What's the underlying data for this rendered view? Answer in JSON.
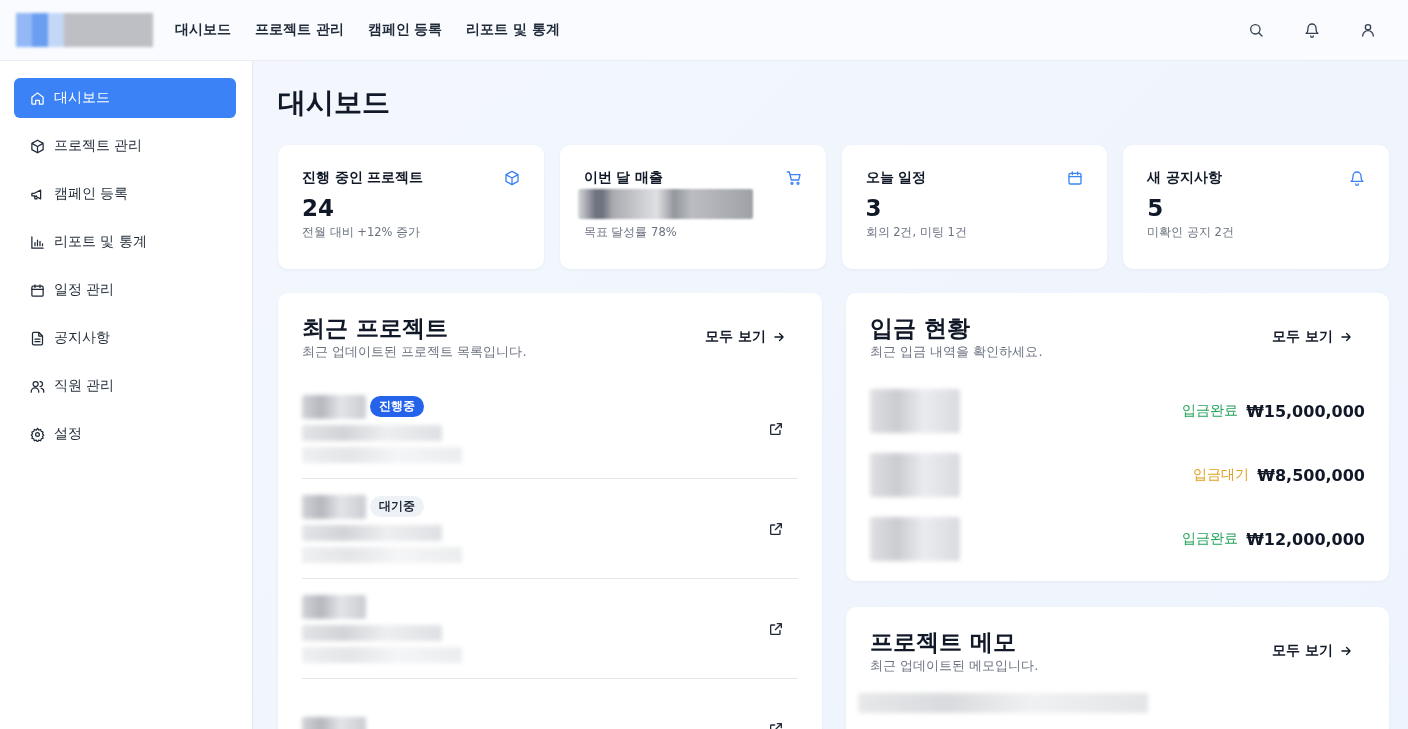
{
  "header": {
    "nav": [
      "대시보드",
      "프로젝트 관리",
      "캠페인 등록",
      "리포트 및 통계"
    ]
  },
  "sidebar": {
    "items": [
      {
        "label": "대시보드",
        "selected": true
      },
      {
        "label": "프로젝트 관리",
        "selected": false
      },
      {
        "label": "캠페인 등록",
        "selected": false
      },
      {
        "label": "리포트 및 통계",
        "selected": false
      },
      {
        "label": "일정 관리",
        "selected": false
      },
      {
        "label": "공지사항",
        "selected": false
      },
      {
        "label": "직원 관리",
        "selected": false
      },
      {
        "label": "설정",
        "selected": false
      }
    ]
  },
  "page_title": "대시보드",
  "stats": [
    {
      "title": "진행 중인 프로젝트",
      "value": "24",
      "note": "전월 대비 +12% 증가"
    },
    {
      "title": "이번 달 매출",
      "note": "목표 달성률 78%"
    },
    {
      "title": "오늘 일정",
      "value": "3",
      "note": "회의 2건, 미팅 1건"
    },
    {
      "title": "새 공지사항",
      "value": "5",
      "note": "미확인 공지 2건"
    }
  ],
  "recent_projects": {
    "title": "최근 프로젝트",
    "subtitle": "최근 업데이트된 프로젝트 목록입니다.",
    "link": "모두 보기",
    "rows": [
      {
        "kind": "active",
        "badge": "진행중"
      },
      {
        "kind": "waiting",
        "badge": "대기중"
      },
      {},
      {}
    ]
  },
  "deposits": {
    "title": "입금 현황",
    "subtitle": "최근 입금 내역을 확인하세요.",
    "link": "모두 보기",
    "rows": [
      {
        "kind": "done",
        "status": "입금완료",
        "amount": "₩15,000,000"
      },
      {
        "kind": "pending",
        "status": "입금대기",
        "amount": "₩8,500,000"
      },
      {
        "kind": "done",
        "status": "입금완료",
        "amount": "₩12,000,000"
      }
    ]
  },
  "memos": {
    "title": "프로젝트 메모",
    "subtitle": "최근 업데이트된 메모입니다.",
    "link": "모두 보기"
  }
}
